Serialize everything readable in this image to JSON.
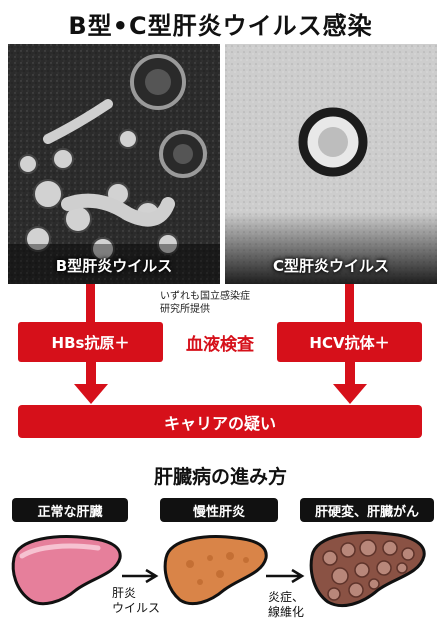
{
  "title": "B型•C型肝炎ウイルス感染",
  "photos": {
    "hbv_label": "B型肝炎ウイルス",
    "hcv_label": "C型肝炎ウイルス",
    "credit_line1": "いずれも国立感染症",
    "credit_line2": "研究所提供"
  },
  "tests": {
    "hbs": "HBs抗原＋",
    "blood": "血液検査",
    "hcv": "HCV抗体＋",
    "carrier": "キャリアの疑い"
  },
  "progression": {
    "title": "肝臓病の進み方",
    "stages": [
      "正常な肝臓",
      "慢性肝炎",
      "肝硬変、肝臓がん"
    ],
    "cause1_line1": "肝炎",
    "cause1_line2": "ウイルス",
    "cause2_line1": "炎症、",
    "cause2_line2": "線維化"
  },
  "colors": {
    "accent_red": "#d6101a",
    "label_black": "#111111",
    "liver_normal": "#e67f9b",
    "liver_chronic": "#d98448",
    "liver_cirrhosis": "#8a5244"
  }
}
